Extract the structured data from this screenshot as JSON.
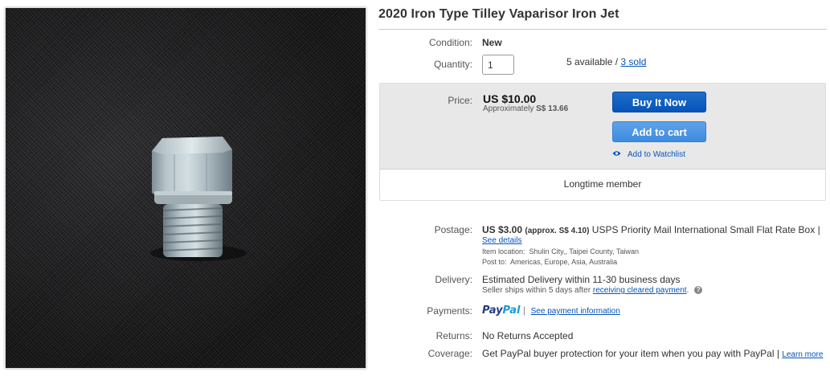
{
  "item": {
    "title": "2020 Iron Type Tilley Vaparisor Iron Jet"
  },
  "condition": {
    "label": "Condition:",
    "value": "New"
  },
  "quantity": {
    "label": "Quantity:",
    "value": "1",
    "available": "5 available",
    "separator": " / ",
    "sold": "3 sold"
  },
  "price": {
    "label": "Price:",
    "amount": "US $10.00",
    "approx_label": "Approximately",
    "approx_value": "S$ 13.66",
    "buy_now_label": "Buy It Now",
    "add_to_cart_label": "Add to cart",
    "watchlist_label": "Add to Watchlist",
    "member_text": "Longtime member"
  },
  "postage": {
    "label": "Postage:",
    "amount": "US $3.00",
    "approx_open": "(approx.",
    "approx_value": "S$ 4.10",
    "approx_close": ")",
    "service": "USPS Priority Mail International Small Flat Rate Box |",
    "details_link": "See details",
    "item_location_label": "Item location:",
    "item_location": "Shulin City,, Taipei County, Taiwan",
    "post_to_label": "Post to:",
    "post_to": "Americas, Europe, Asia, Australia"
  },
  "delivery": {
    "label": "Delivery:",
    "estimate": "Estimated Delivery within 11-30 business days",
    "seller_ships": "Seller ships within 5 days after",
    "cleared_payment_link": "receiving cleared payment",
    "period": ".",
    "help_glyph": "?"
  },
  "payments": {
    "label": "Payments:",
    "paypal_pay": "Pay",
    "paypal_pal": "Pal",
    "separator": "|",
    "see_info_link": "See payment information"
  },
  "returns": {
    "label": "Returns:",
    "value": "No Returns Accepted"
  },
  "coverage": {
    "label": "Coverage:",
    "text": "Get PayPal buyer protection for your item when you pay with PayPal |",
    "learn_more_link": "Learn more"
  },
  "colors": {
    "buy_now": "#0654ba",
    "add_to_cart": "#3d8be0",
    "link": "#0654ba",
    "price_box": "#e8e8e8"
  },
  "icons": {
    "watchlist": "eye-icon",
    "help": "help-icon"
  }
}
